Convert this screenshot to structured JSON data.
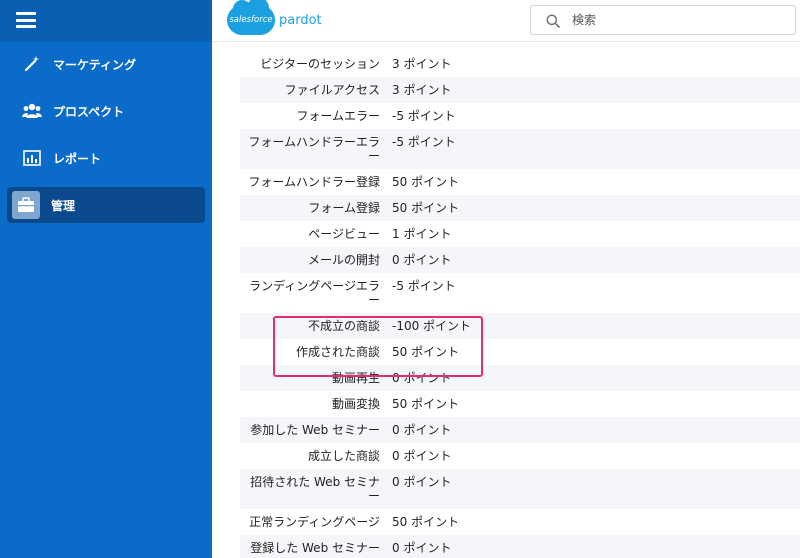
{
  "nav": {
    "items": [
      {
        "label": "マーケティング",
        "icon": "magic-wand-icon",
        "active": false
      },
      {
        "label": "プロスペクト",
        "icon": "people-icon",
        "active": false
      },
      {
        "label": "レポート",
        "icon": "bar-chart-icon",
        "active": false
      },
      {
        "label": "管理",
        "icon": "briefcase-icon",
        "active": true
      }
    ]
  },
  "header": {
    "logo_text": "salesforce",
    "brand": "pardot",
    "search_placeholder": "検索"
  },
  "table": {
    "rows": [
      {
        "name": "ビジターのセッション",
        "value": "3 ポイント"
      },
      {
        "name": "ファイルアクセス",
        "value": "3 ポイント"
      },
      {
        "name": "フォームエラー",
        "value": "-5 ポイント"
      },
      {
        "name": "フォームハンドラーエラー",
        "value": "-5 ポイント"
      },
      {
        "name": "フォームハンドラー登録",
        "value": "50 ポイント"
      },
      {
        "name": "フォーム登録",
        "value": "50 ポイント"
      },
      {
        "name": "ページビュー",
        "value": "1 ポイント"
      },
      {
        "name": "メールの開封",
        "value": "0 ポイント"
      },
      {
        "name": "ランディングページエラー",
        "value": "-5 ポイント"
      },
      {
        "name": "不成立の商談",
        "value": "-100 ポイント"
      },
      {
        "name": "作成された商談",
        "value": "50 ポイント"
      },
      {
        "name": "動画再生",
        "value": "0 ポイント"
      },
      {
        "name": "動画変換",
        "value": "50 ポイント"
      },
      {
        "name": "参加した Web セミナー",
        "value": "0 ポイント"
      },
      {
        "name": "成立した商談",
        "value": "0 ポイント"
      },
      {
        "name": "招待された Web セミナー",
        "value": "0 ポイント"
      },
      {
        "name": "正常ランディングページ",
        "value": "50 ポイント"
      },
      {
        "name": "登録した Web セミナー",
        "value": "0 ポイント"
      }
    ]
  },
  "colors": {
    "sidebar": "#0b6bc8",
    "sidebar_active": "#0a4a8c",
    "highlight": "#e42d73",
    "brand": "#1ba1e2"
  }
}
